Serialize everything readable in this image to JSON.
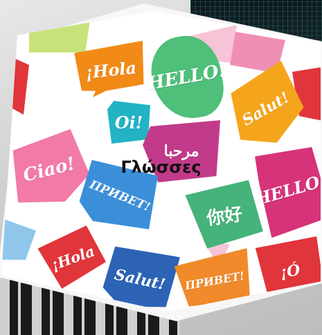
{
  "title": "Γλώσσες",
  "bubbles": [
    {
      "text": "¡Hola",
      "color": "#f28a17"
    },
    {
      "text": "HELLO!",
      "color": "#4fbf7a"
    },
    {
      "text": "Oi!",
      "color": "#22b3c4"
    },
    {
      "text": "Salut!",
      "color": "#f5a51b"
    },
    {
      "text": "مرحبا",
      "color": "#c23a8a"
    },
    {
      "text": "Ciao!",
      "color": "#f27aa8"
    },
    {
      "text": "ПРИВЕТ!",
      "color": "#3b8fd9"
    },
    {
      "text": "HELLO!",
      "color": "#d6337a"
    },
    {
      "text": "你好",
      "color": "#45b37a"
    },
    {
      "text": "¡Hola",
      "color": "#e0353a"
    },
    {
      "text": "Salut!",
      "color": "#2c63b5"
    },
    {
      "text": "ПРИВЕТ!",
      "color": "#f08a2a"
    },
    {
      "text": "¡Ó",
      "color": "#e0353a"
    }
  ],
  "colors": {
    "accent_red": "#e0353a",
    "accent_pink": "#f08fb5",
    "accent_green": "#c8e27a"
  }
}
